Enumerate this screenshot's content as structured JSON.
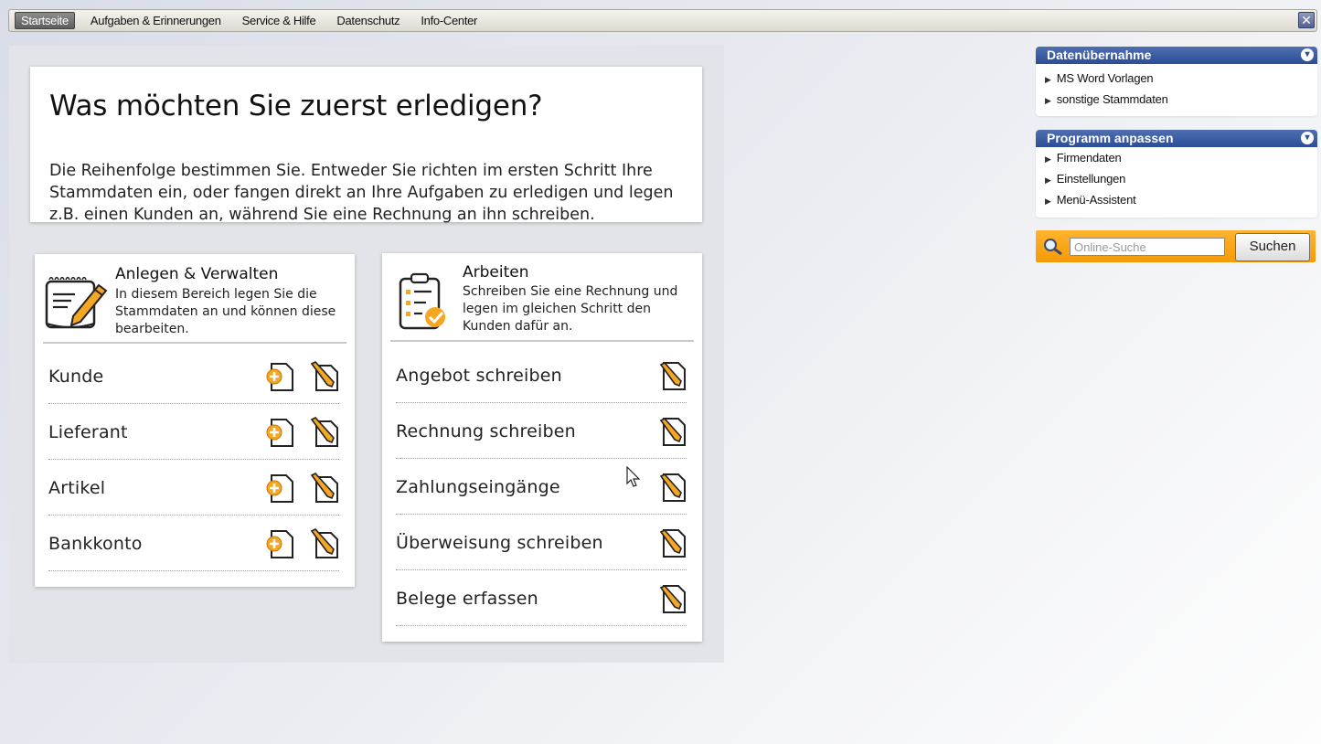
{
  "menu": {
    "tabs": [
      {
        "label": "Startseite",
        "active": true
      },
      {
        "label": "Aufgaben & Erinnerungen",
        "active": false
      },
      {
        "label": "Service & Hilfe",
        "active": false
      },
      {
        "label": "Datenschutz",
        "active": false
      },
      {
        "label": "Info-Center",
        "active": false
      }
    ],
    "close_glyph": "✕"
  },
  "hero": {
    "title": "Was möchten Sie zuerst erledigen?",
    "text": "Die Reihenfolge bestimmen Sie. Entweder Sie richten im ersten Schritt Ihre Stammdaten ein, oder fangen direkt an Ihre Aufgaben zu erledigen und legen z.B. einen Kunden an, während Sie eine Rechnung an ihn schreiben."
  },
  "left_panel": {
    "title": "Anlegen & Verwalten",
    "description": "In diesem Bereich legen Sie die Stammdaten an und können diese bearbeiten.",
    "icon": "notepad-pencil-icon",
    "rows": [
      {
        "label": "Kunde"
      },
      {
        "label": "Lieferant"
      },
      {
        "label": "Artikel"
      },
      {
        "label": "Bankkonto"
      }
    ]
  },
  "right_panel": {
    "title": "Arbeiten",
    "description": "Schreiben Sie eine Rechnung und legen im gleichen Schritt den Kunden dafür an.",
    "icon": "clipboard-checklist-icon",
    "rows": [
      {
        "label": "Angebot schreiben"
      },
      {
        "label": "Rechnung schreiben"
      },
      {
        "label": "Zahlungseingänge"
      },
      {
        "label": "Überweisung schreiben"
      },
      {
        "label": "Belege erfassen"
      }
    ]
  },
  "sidebar": {
    "import": {
      "title": "Datenübernahme",
      "items": [
        "MS Word Vorlagen",
        "sonstige Stammdaten"
      ]
    },
    "customize": {
      "title": "Programm anpassen",
      "items": [
        "Firmendaten",
        "Einstellungen",
        "Menü-Assistent"
      ]
    },
    "search": {
      "placeholder": "Online-Suche",
      "button_label": "Suchen"
    }
  },
  "colors": {
    "accent_orange": "#f59a07",
    "header_blue": "#2b4d96"
  }
}
